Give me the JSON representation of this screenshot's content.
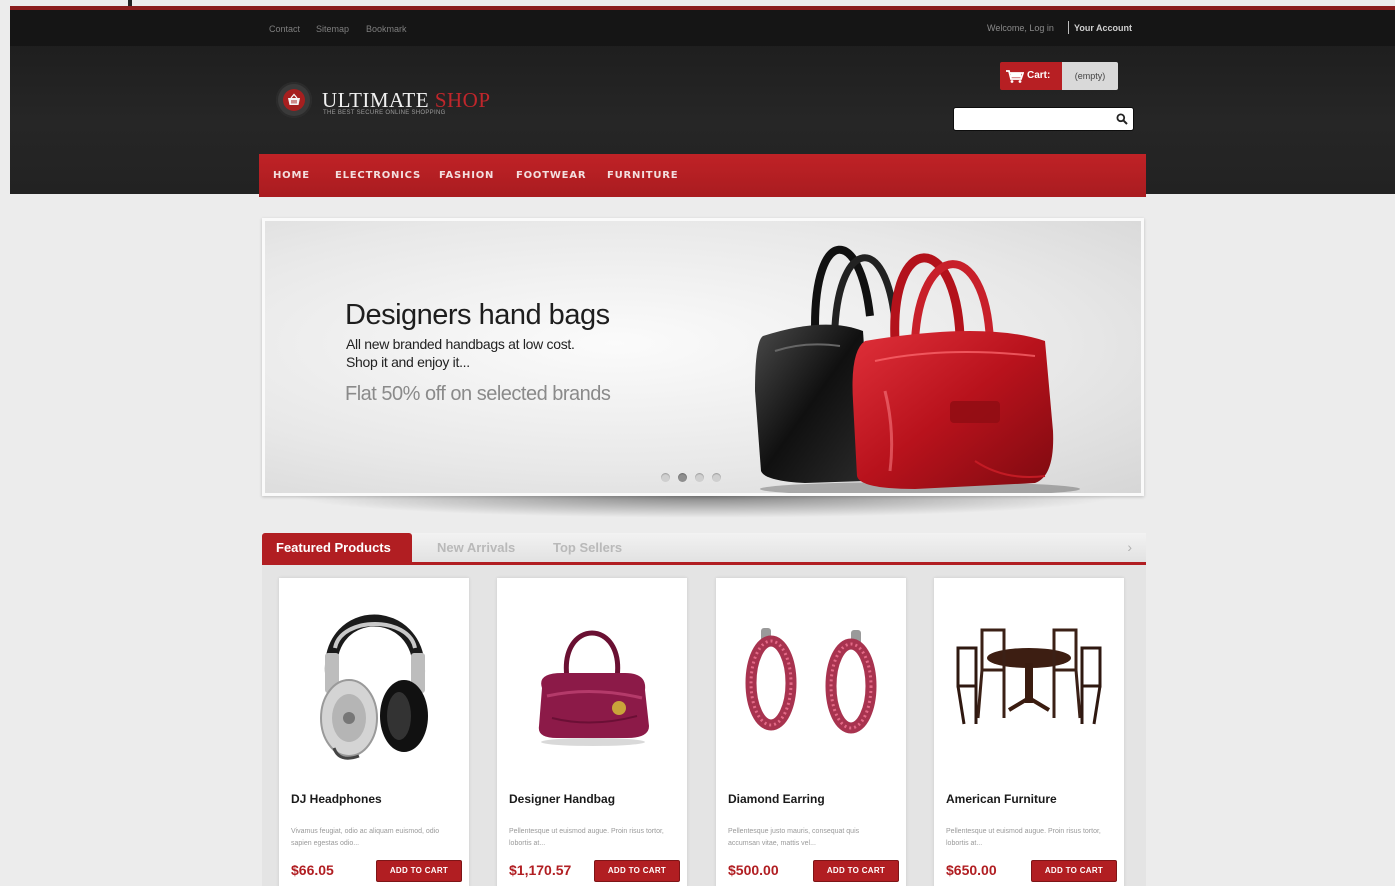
{
  "topbar": {
    "links": [
      "Contact",
      "Sitemap",
      "Bookmark"
    ],
    "welcome": "Welcome, Log in",
    "account": "Your Account"
  },
  "logo": {
    "name_part1": "ULTIMATE",
    "name_part2": "SHOP",
    "tagline": "THE BEST SECURE ONLINE SHOPPING"
  },
  "cart": {
    "label": "Cart:",
    "value": "(empty)"
  },
  "search": {
    "placeholder": ""
  },
  "nav": {
    "items": [
      "HOME",
      "ELECTRONICS",
      "FASHION",
      "FOOTWEAR",
      "FURNITURE"
    ]
  },
  "banner": {
    "title": "Designers hand bags",
    "line1": "All new branded handbags at low cost.",
    "line2": "Shop it and enjoy it...",
    "offer": "Flat 50% off on selected brands",
    "slides_total": 4,
    "active_slide": 2
  },
  "tabs": {
    "items": [
      "Featured Products",
      "New Arrivals",
      "Top Sellers"
    ],
    "active": "Featured Products",
    "next_symbol": "›"
  },
  "products": [
    {
      "name": "DJ Headphones",
      "desc": "Vivamus feugiat, odio ac aliquam euismod, odio sapien egestas odio...",
      "price": "$66.05",
      "button": "ADD TO CART",
      "image": "headphones"
    },
    {
      "name": "Designer Handbag",
      "desc": "Pellentesque ut euismod augue. Proin risus tortor, lobortis at...",
      "price": "$1,170.57",
      "button": "ADD TO CART",
      "image": "handbag"
    },
    {
      "name": "Diamond Earring",
      "desc": "Pellentesque justo mauris, consequat quis accumsan vitae, mattis vel...",
      "price": "$500.00",
      "button": "ADD TO CART",
      "image": "earrings"
    },
    {
      "name": "American Furniture",
      "desc": "Pellentesque ut euismod augue. Proin risus tortor, lobortis at...",
      "price": "$650.00",
      "button": "ADD TO CART",
      "image": "dining-set"
    }
  ],
  "colors": {
    "accent": "#b11e22",
    "header_bg": "#1f1f1f",
    "page_bg": "#ececec"
  }
}
